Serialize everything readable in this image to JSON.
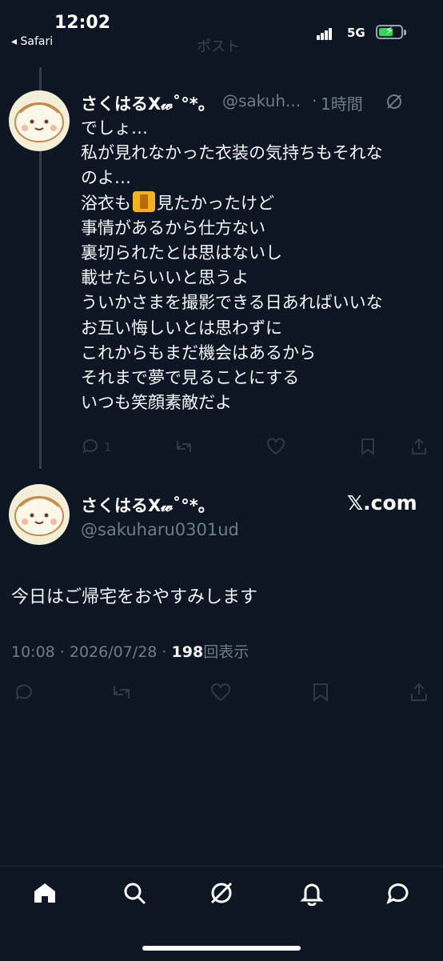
{
  "status": {
    "time": "12:02",
    "back_label": "◂ Safari",
    "network": "5G"
  },
  "header": {
    "title": "ポスト"
  },
  "reply_tweet": {
    "author": "さくはるX𝓌˚°*。",
    "handle": "@sakuh...",
    "time": "1時間",
    "lines": [
      "でしょ…",
      "私が見れなかった衣装の気持ちもそれな",
      "のよ…",
      "事情があるから仕方ない",
      "裏切られたとは思はないし",
      "載せたらいいと思うよ",
      "ういかさまを撮影できる日あればいいな",
      "お互い悔しいとは思わずに",
      "これからもまだ機会はあるから",
      "それまで夢で見ることにする",
      "いつも笑顔素敵だよ"
    ],
    "emoji_line": {
      "before": "浴衣も",
      "after": "見たかったけど"
    },
    "reply_count": "1"
  },
  "main_tweet": {
    "author": "さくはるX𝓌˚°*。",
    "handle": "@sakuharu0301ud",
    "watermark": "𝕏.com",
    "text": "今日はご帰宅をおやすみします",
    "timestamp": "10:08 · 2026/07/28 · ",
    "views": "198",
    "views_label": "回表示"
  },
  "icons": [
    "home-icon",
    "search-icon",
    "grok-icon",
    "bell-icon",
    "message-icon"
  ]
}
